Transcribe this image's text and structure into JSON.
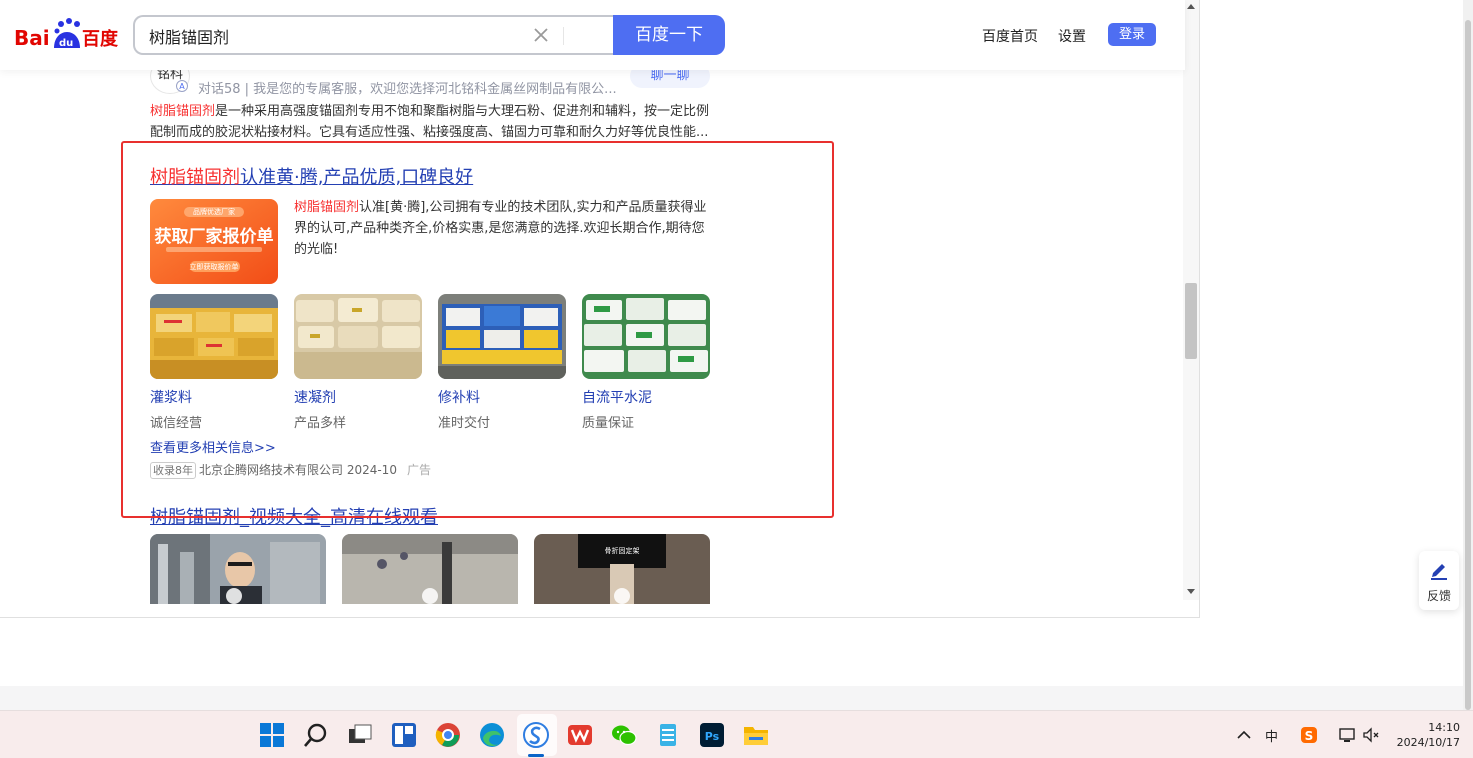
{
  "header": {
    "search_value": "树脂锚固剂",
    "search_button": "百度一下",
    "nav": [
      "百度首页",
      "设置"
    ],
    "login": "登录"
  },
  "prev_result": {
    "avatar_text": "铭科",
    "meta": "对话58 | 我是您的专属客服，欢迎您选择河北铭科金属丝网制品有限公...",
    "chat_button": "聊一聊",
    "desc_highlight": "树脂锚固剂",
    "desc": "是一种采用高强度锚固剂专用不饱和聚酯树脂与大理石粉、促进剂和辅料，按一定比例配制而成的胶泥状粘接材料。它具有适应性强、粘接强度高、锚固力可靠和耐久力好等优良性能..."
  },
  "ad": {
    "title_highlight": "树脂锚固剂",
    "title_rest": "认准黄·腾,产品优质,口碑良好",
    "thumb_text_top": "品牌优选厂家",
    "thumb_text_main": "获取厂家报价单",
    "thumb_text_bottom": "立即获取报价单",
    "desc_highlight": "树脂锚固剂",
    "desc": "认准[黄·腾],公司拥有专业的技术团队,实力和产品质量获得业界的认可,产品种类齐全,价格实惠,是您满意的选择.欢迎长期合作,期待您的光临!",
    "gallery": [
      {
        "title": "灌浆料",
        "sub": "诚信经营"
      },
      {
        "title": "速凝剂",
        "sub": "产品多样"
      },
      {
        "title": "修补料",
        "sub": "准时交付"
      },
      {
        "title": "自流平水泥",
        "sub": "质量保证"
      }
    ],
    "more": "查看更多相关信息>>",
    "badge": "收录8年",
    "company": "北京企腾网络技术有限公司 2024-10",
    "ad_tag": "广告"
  },
  "video": {
    "title": "树脂锚固剂_视频大全_高清在线观看",
    "thumb_caption": "骨折固定架"
  },
  "side": {
    "feedback": "反馈"
  },
  "taskbar": {
    "time": "14:10",
    "date": "2024/10/17",
    "ime": "中"
  },
  "colors": {
    "accent": "#4e6ef2",
    "link": "#2440b3",
    "highlight": "#f73131",
    "annotation_box": "#e8302e"
  }
}
